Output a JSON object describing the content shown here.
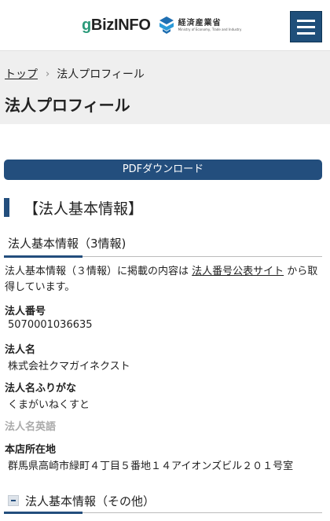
{
  "header": {
    "logo_prefix": "g",
    "logo_main": "BizINFO",
    "meti_jp": "経済産業省",
    "meti_en": "Ministry of Economy, Trade and Industry",
    "menu_icon": "hamburger-menu-icon"
  },
  "breadcrumb": {
    "home": "トップ",
    "separator": "›",
    "current": "法人プロフィール"
  },
  "page_title": "法人プロフィール",
  "pdf_button": "PDFダウンロード",
  "section": {
    "title": "【法人基本情報】",
    "subsection_title": "法人基本情報（3情報)",
    "description_before": "法人基本情報（３情報）に掲載の内容は ",
    "description_link": "法人番号公表サイト",
    "description_after": " から取得しています。"
  },
  "fields": [
    {
      "label": "法人番号",
      "value": "5070001036635"
    },
    {
      "label": "法人名",
      "value": "株式会社クマガイネクスト"
    },
    {
      "label": "法人名ふりがな",
      "value": "くまがいねくすと"
    },
    {
      "label": "法人名英語",
      "value": ""
    },
    {
      "label": "本店所在地",
      "value": "群馬県高崎市緑町４丁目５番地１４アイオンズビル２０１号室"
    }
  ],
  "subsection2_title": "法人基本情報（その他）",
  "colors": {
    "primary": "#234e7d",
    "accent_green": "#2b9a7a",
    "gray_band": "#efefef"
  }
}
